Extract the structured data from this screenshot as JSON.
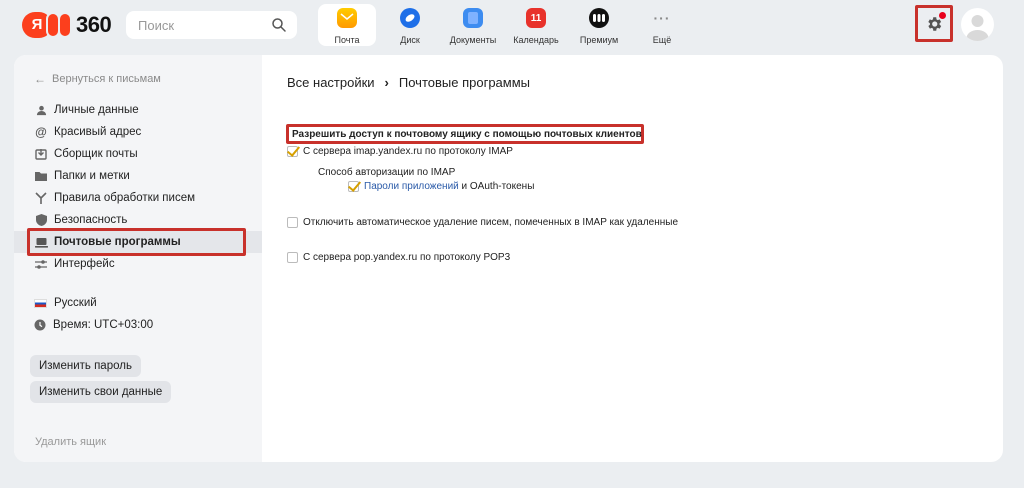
{
  "header": {
    "logo_ya": "Я",
    "logo_text": "360",
    "search_placeholder": "Поиск",
    "services": [
      {
        "label": "Почта",
        "icon": "mail-icon"
      },
      {
        "label": "Диск",
        "icon": "disk-icon"
      },
      {
        "label": "Документы",
        "icon": "docs-icon"
      },
      {
        "label": "Календарь",
        "icon": "calendar-icon",
        "badge": "11"
      },
      {
        "label": "Премиум",
        "icon": "premium-icon"
      },
      {
        "label": "Ещё",
        "icon": "more-icon",
        "glyph": "···"
      }
    ],
    "active_service": "Почта"
  },
  "sidebar": {
    "back_label": "Вернуться к письмам",
    "items": [
      {
        "label": "Личные данные",
        "icon": "person-icon"
      },
      {
        "label": "Красивый адрес",
        "icon": "at-icon"
      },
      {
        "label": "Сборщик почты",
        "icon": "inbox-collector-icon"
      },
      {
        "label": "Папки и метки",
        "icon": "folder-icon"
      },
      {
        "label": "Правила обработки писем",
        "icon": "rules-icon"
      },
      {
        "label": "Безопасность",
        "icon": "shield-icon"
      },
      {
        "label": "Почтовые программы",
        "icon": "laptop-icon"
      },
      {
        "label": "Интерфейс",
        "icon": "sliders-icon"
      }
    ],
    "active_item": "Почтовые программы",
    "language": "Русский",
    "timezone": "Время: UTC+03:00",
    "change_password": "Изменить пароль",
    "change_data": "Изменить свои данные",
    "delete_box": "Удалить ящик"
  },
  "content": {
    "breadcrumb_root": "Все настройки",
    "breadcrumb_sep": "›",
    "breadcrumb_current": "Почтовые программы",
    "section_title": "Разрешить доступ к почтовому ящику с помощью почтовых клиентов",
    "imap_option": {
      "label": "С сервера imap.yandex.ru по протоколу IMAP",
      "checked": true
    },
    "auth_method_label": "Способ авторизации по IMAP",
    "app_passwords": {
      "link": "Пароли приложений",
      "rest": " и OAuth-токены",
      "checked": true
    },
    "disable_autodelete": {
      "label": "Отключить автоматическое удаление писем, помеченных в IMAP как удаленные",
      "checked": false
    },
    "pop3_option": {
      "label": "С сервера pop.yandex.ru по протоколу POP3",
      "checked": false
    }
  },
  "colors": {
    "highlight": "#c8312b",
    "accent_check": "#d6a000",
    "link": "#2a5aa8",
    "background": "#ebeef1"
  }
}
